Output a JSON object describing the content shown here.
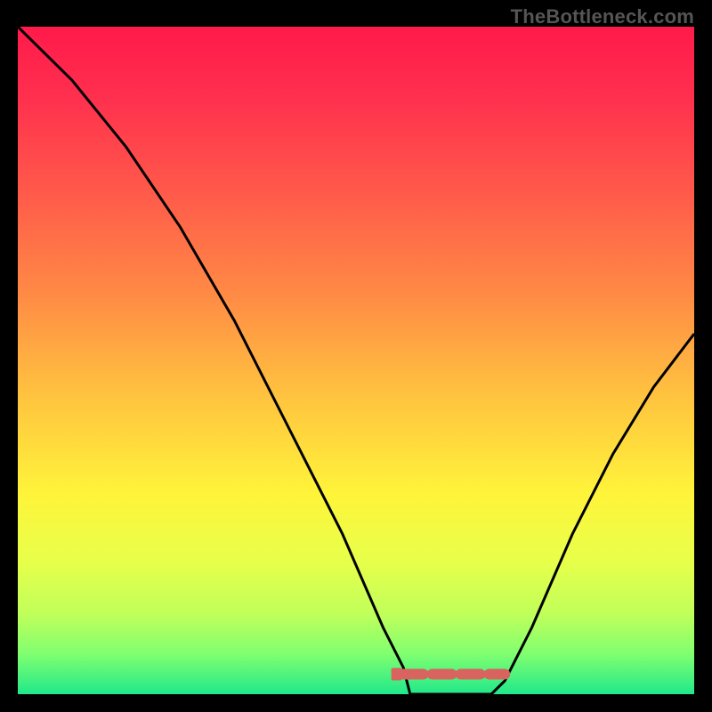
{
  "watermark": "TheBottleneck.com",
  "chart_data": {
    "type": "line",
    "title": "",
    "xlabel": "",
    "ylabel": "",
    "xlim": [
      0,
      100
    ],
    "ylim": [
      0,
      100
    ],
    "curve": [
      {
        "x": 0,
        "y": 100
      },
      {
        "x": 8,
        "y": 92
      },
      {
        "x": 16,
        "y": 82
      },
      {
        "x": 24,
        "y": 70
      },
      {
        "x": 32,
        "y": 56
      },
      {
        "x": 40,
        "y": 40
      },
      {
        "x": 48,
        "y": 24
      },
      {
        "x": 54,
        "y": 10
      },
      {
        "x": 57,
        "y": 4
      },
      {
        "x": 58,
        "y": 0
      },
      {
        "x": 62,
        "y": 0
      },
      {
        "x": 66,
        "y": 0
      },
      {
        "x": 70,
        "y": 0
      },
      {
        "x": 72,
        "y": 2
      },
      {
        "x": 76,
        "y": 10
      },
      {
        "x": 82,
        "y": 24
      },
      {
        "x": 88,
        "y": 36
      },
      {
        "x": 94,
        "y": 46
      },
      {
        "x": 100,
        "y": 54
      }
    ],
    "optimal_band": {
      "x_start": 56,
      "x_end": 72,
      "y": 3
    },
    "gradient_stops": [
      {
        "offset": 0.0,
        "color": "#ff1a4a"
      },
      {
        "offset": 0.1,
        "color": "#ff2e4e"
      },
      {
        "offset": 0.25,
        "color": "#ff5a4a"
      },
      {
        "offset": 0.4,
        "color": "#ff8a45"
      },
      {
        "offset": 0.55,
        "color": "#ffc23f"
      },
      {
        "offset": 0.7,
        "color": "#fff43a"
      },
      {
        "offset": 0.8,
        "color": "#e8ff4a"
      },
      {
        "offset": 0.88,
        "color": "#c0ff5a"
      },
      {
        "offset": 0.94,
        "color": "#80ff70"
      },
      {
        "offset": 1.0,
        "color": "#20e88a"
      }
    ],
    "marker_color": "#d9635f",
    "curve_color": "#000000"
  }
}
